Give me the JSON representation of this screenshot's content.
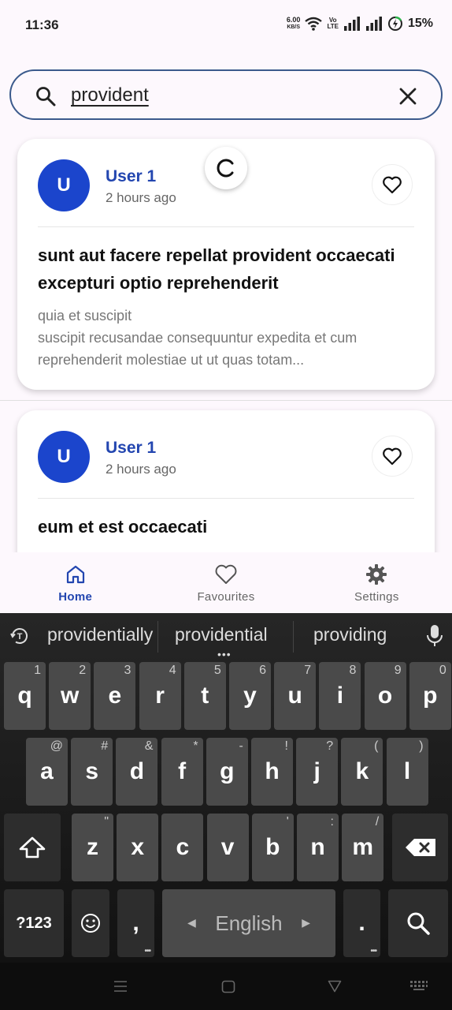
{
  "status_bar": {
    "time": "11:36",
    "net_speed_value": "6.00",
    "net_speed_unit": "KB/S",
    "volte_top": "Vo",
    "volte_bottom": "LTE",
    "battery": "15%"
  },
  "search": {
    "query": "provident"
  },
  "posts": [
    {
      "avatar_letter": "U",
      "user": "User 1",
      "time": "2 hours ago",
      "title": "sunt aut facere repellat provident occaecati excepturi optio reprehenderit",
      "body": "quia et suscipit\nsuscipit recusandae consequuntur expedita et cum reprehenderit molestiae ut ut quas totam..."
    },
    {
      "avatar_letter": "U",
      "user": "User 1",
      "time": "2 hours ago",
      "title": "eum et est occaecati",
      "body": ""
    }
  ],
  "bottom_nav": [
    {
      "label": "Home",
      "icon": "home-icon",
      "active": true
    },
    {
      "label": "Favourites",
      "icon": "heart-icon",
      "active": false
    },
    {
      "label": "Settings",
      "icon": "gear-icon",
      "active": false
    }
  ],
  "keyboard": {
    "suggestions": [
      "providentially",
      "providential",
      "providing"
    ],
    "row1": [
      {
        "k": "q",
        "h": "1"
      },
      {
        "k": "w",
        "h": "2"
      },
      {
        "k": "e",
        "h": "3"
      },
      {
        "k": "r",
        "h": "4"
      },
      {
        "k": "t",
        "h": "5"
      },
      {
        "k": "y",
        "h": "6"
      },
      {
        "k": "u",
        "h": "7"
      },
      {
        "k": "i",
        "h": "8"
      },
      {
        "k": "o",
        "h": "9"
      },
      {
        "k": "p",
        "h": "0"
      }
    ],
    "row2": [
      {
        "k": "a",
        "h": "@"
      },
      {
        "k": "s",
        "h": "#"
      },
      {
        "k": "d",
        "h": "&"
      },
      {
        "k": "f",
        "h": "*"
      },
      {
        "k": "g",
        "h": "-"
      },
      {
        "k": "h",
        "h": "!"
      },
      {
        "k": "j",
        "h": "?"
      },
      {
        "k": "k",
        "h": "("
      },
      {
        "k": "l",
        "h": ")"
      }
    ],
    "row3": [
      {
        "k": "z",
        "h": "\""
      },
      {
        "k": "x",
        "h": ""
      },
      {
        "k": "c",
        "h": ""
      },
      {
        "k": "v",
        "h": ""
      },
      {
        "k": "b",
        "h": "'"
      },
      {
        "k": "n",
        "h": ":"
      },
      {
        "k": "m",
        "h": "/"
      }
    ],
    "symbols_label": "?123",
    "comma_label": ",",
    "space_label": "English",
    "period_label": "."
  },
  "colors": {
    "accent": "#2346b0",
    "avatar_bg": "#1b45cc",
    "search_border": "#3b5a8c"
  }
}
